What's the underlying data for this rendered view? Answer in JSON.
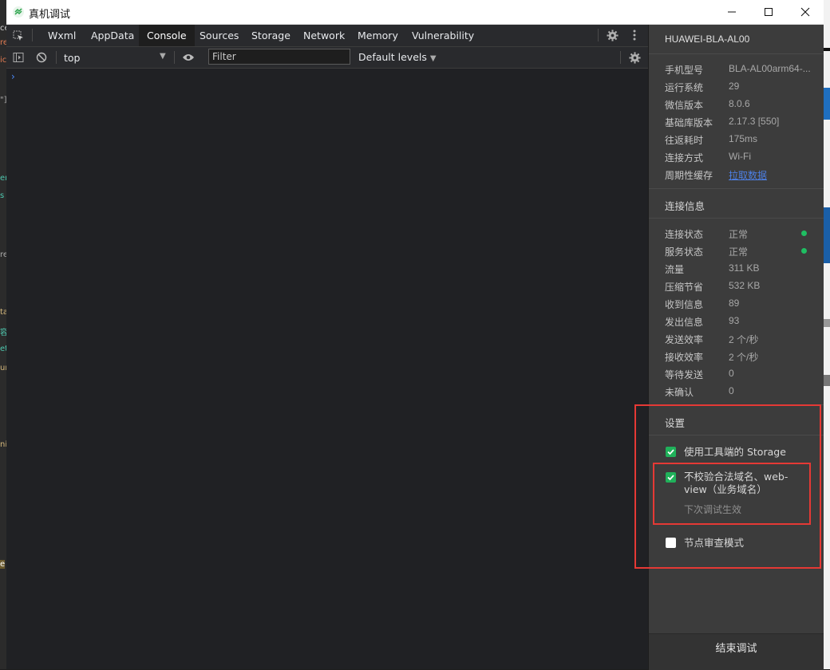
{
  "window": {
    "title": "真机调试"
  },
  "devtools": {
    "tabs": [
      "Wxml",
      "AppData",
      "Console",
      "Sources",
      "Storage",
      "Network",
      "Memory",
      "Vulnerability"
    ],
    "active_tab": "Console",
    "context": "top",
    "filter_placeholder": "Filter",
    "levels_label": "Default levels",
    "prompt_symbol": "›"
  },
  "panel": {
    "device_name": "HUAWEI-BLA-AL00",
    "device_info": [
      {
        "label": "手机型号",
        "value": "BLA-AL00arm64-..."
      },
      {
        "label": "运行系统",
        "value": "29"
      },
      {
        "label": "微信版本",
        "value": "8.0.6"
      },
      {
        "label": "基础库版本",
        "value": "2.17.3 [550]"
      },
      {
        "label": "往返耗时",
        "value": "175ms"
      },
      {
        "label": "连接方式",
        "value": "Wi-Fi"
      },
      {
        "label": "周期性缓存",
        "value": "拉取数据"
      }
    ],
    "connection_title": "连接信息",
    "connection_info": [
      {
        "label": "连接状态",
        "value": "正常"
      },
      {
        "label": "服务状态",
        "value": "正常"
      },
      {
        "label": "流量",
        "value": "311 KB"
      },
      {
        "label": "压缩节省",
        "value": "532 KB"
      },
      {
        "label": "收到信息",
        "value": "89"
      },
      {
        "label": "发出信息",
        "value": "93"
      },
      {
        "label": "发送效率",
        "value": "2 个/秒"
      },
      {
        "label": "接收效率",
        "value": "2 个/秒"
      },
      {
        "label": "等待发送",
        "value": "0"
      },
      {
        "label": "未确认",
        "value": "0"
      }
    ],
    "status_color": "#1fbe62",
    "settings_title": "设置",
    "settings": {
      "use_storage": {
        "label": "使用工具端的 Storage",
        "checked": true
      },
      "skip_domain": {
        "label_line1": "不校验合法域名、web-",
        "label_line2": "view（业务域名）",
        "hint": "下次调试生效",
        "checked": true
      },
      "node_inspect": {
        "label": "节点审查模式",
        "checked": false
      }
    },
    "end_button": "结束调试"
  },
  "colors": {
    "accent_green": "#20b15a",
    "link_blue": "#4d7fe3",
    "highlight_red": "#e53935"
  }
}
